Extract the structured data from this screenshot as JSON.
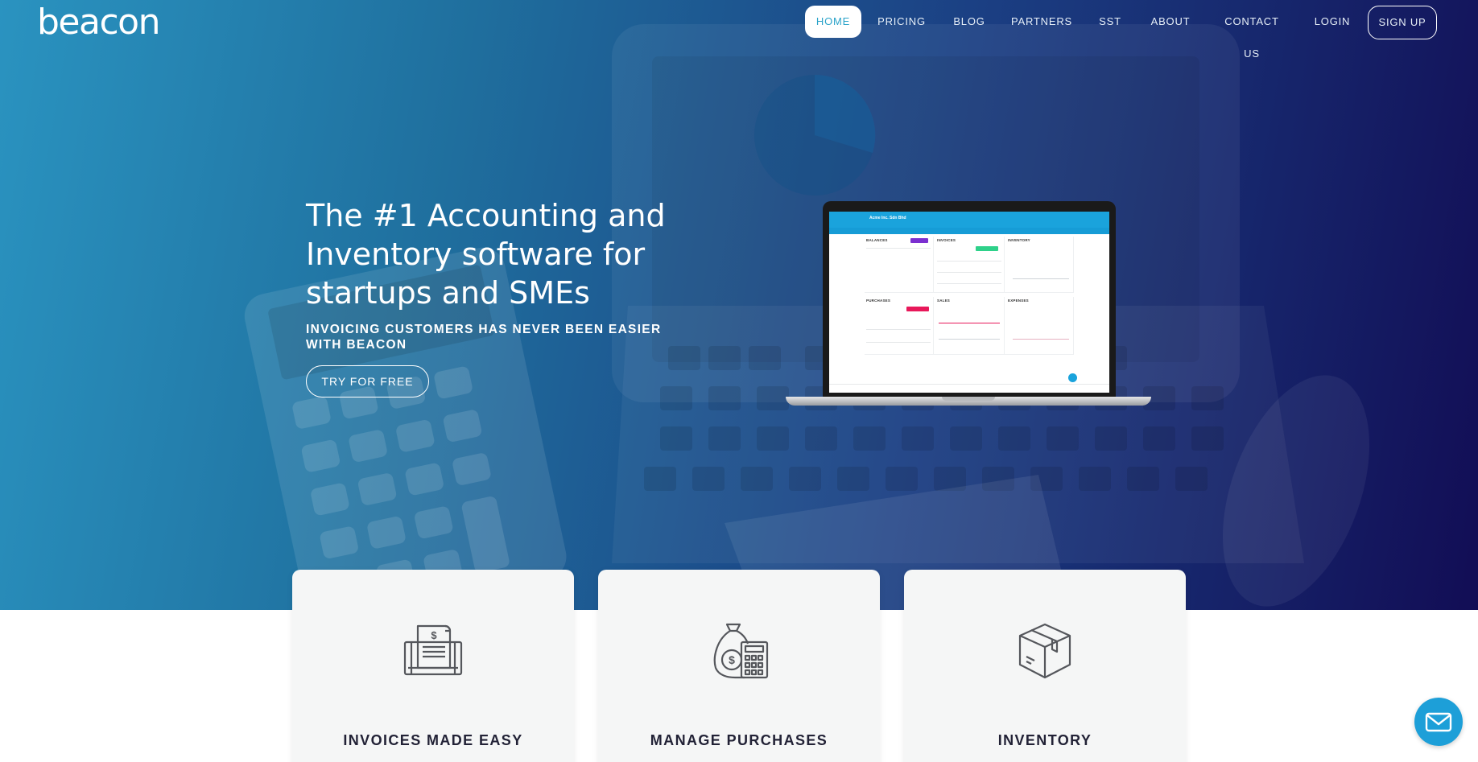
{
  "brand": {
    "logo_text": "beacon"
  },
  "nav": {
    "items": [
      {
        "label": "HOME",
        "active": true
      },
      {
        "label": "PRICING"
      },
      {
        "label": "BLOG"
      },
      {
        "label": "PARTNERS"
      },
      {
        "label": "SST"
      },
      {
        "label": "ABOUT"
      },
      {
        "label": "CONTACT US"
      },
      {
        "label": "LOGIN"
      }
    ],
    "signup_label": "SIGN UP"
  },
  "hero": {
    "headline": "The #1 Accounting and Inventory software for startups and SMEs",
    "subheadline": "INVOICING CUSTOMERS HAS NEVER BEEN EASIER WITH BEACON",
    "cta_label": "TRY FOR FREE",
    "screen_company": "Acme Inc. Sdn Bhd",
    "screen_panels": {
      "balances": "BALANCES",
      "invoices": "INVOICES",
      "inventory": "INVENTORY",
      "purchases": "PURCHASES",
      "sales": "SALES",
      "expenses": "EXPENSES"
    }
  },
  "features": [
    {
      "title": "INVOICES MADE EASY",
      "icon": "invoice-printer-icon"
    },
    {
      "title": "MANAGE PURCHASES",
      "icon": "money-bag-calculator-icon"
    },
    {
      "title": "INVENTORY",
      "icon": "package-box-icon"
    }
  ],
  "chat": {
    "icon": "mail-icon"
  },
  "colors": {
    "hero_start": "#2a93c0",
    "hero_end": "#120d55",
    "accent": "#2aa3c9",
    "card_bg": "#f5f6f6",
    "card_title": "#222236"
  }
}
